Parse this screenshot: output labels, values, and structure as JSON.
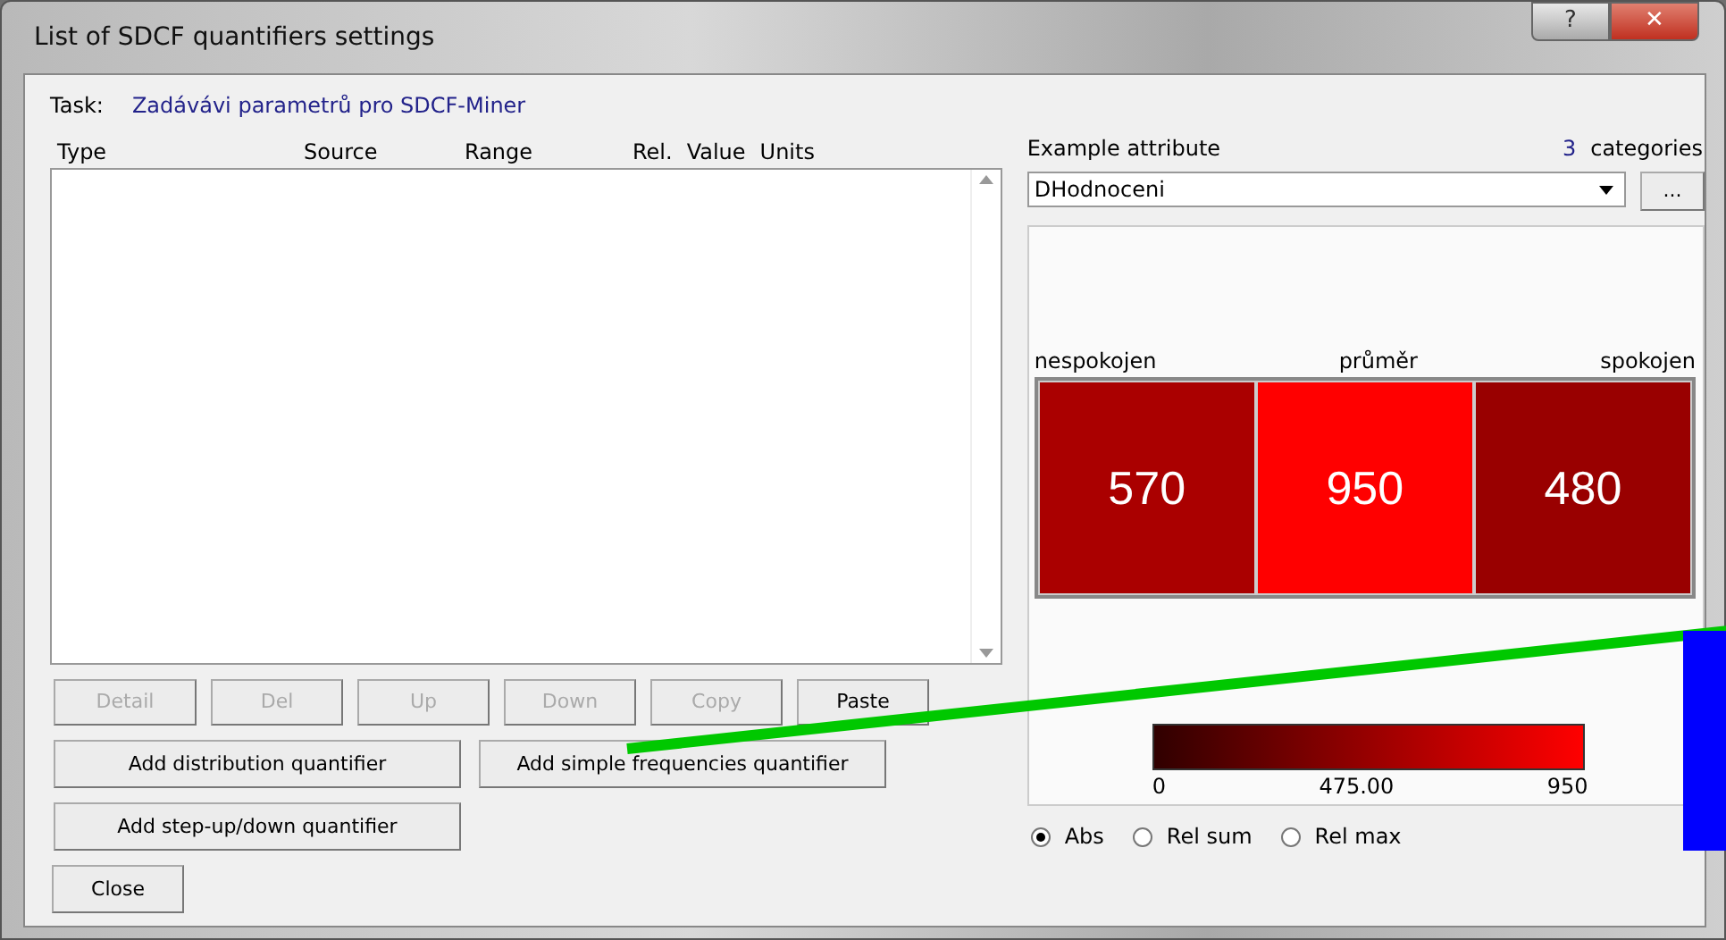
{
  "window": {
    "title": "List of SDCF quantifiers settings",
    "buttons": [
      "?",
      "✕"
    ]
  },
  "task": {
    "label": "Task:",
    "value": "Zadávávi parametrů pro SDCF-Miner"
  },
  "table": {
    "columns": [
      "Type",
      "Source",
      "Range",
      "Rel.",
      "Value",
      "Units"
    ]
  },
  "row_buttons": [
    {
      "label": "Detail",
      "disabled": true
    },
    {
      "label": "Del",
      "disabled": true
    },
    {
      "label": "Up",
      "disabled": true
    },
    {
      "label": "Down",
      "disabled": true
    },
    {
      "label": "Copy",
      "disabled": true
    },
    {
      "label": "Paste",
      "disabled": false
    }
  ],
  "add_buttons": [
    "Add distribution quantifier",
    "Add simple frequencies quantifier",
    "Add step-up/down quantifier"
  ],
  "close_button": "Close",
  "example": {
    "label": "Example attribute",
    "count": "3",
    "count_label": "categories",
    "attribute": "DHodnoceni",
    "browse": "..."
  },
  "heatmap": {
    "cells": [
      {
        "category": "nespokojen",
        "value": "570",
        "color": "#aa0000"
      },
      {
        "category": "průměr",
        "value": "950",
        "color": "#ff0000"
      },
      {
        "category": "spokojen",
        "value": "480",
        "color": "#990000"
      }
    ],
    "scale": {
      "min": "0",
      "mid": "475.00",
      "max": "950"
    }
  },
  "modes": [
    {
      "label": "Abs",
      "selected": true
    },
    {
      "label": "Rel sum",
      "selected": false
    },
    {
      "label": "Rel max",
      "selected": false
    }
  ]
}
